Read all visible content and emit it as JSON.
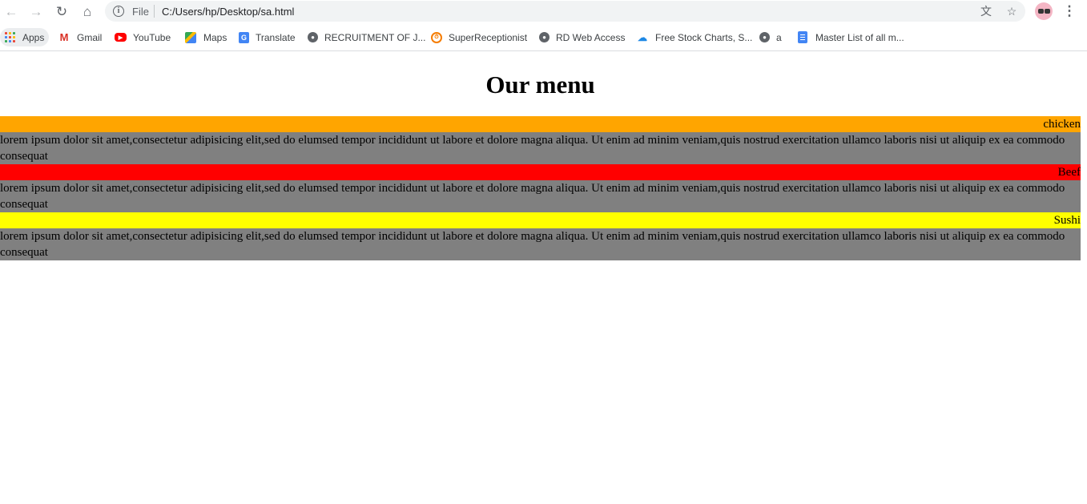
{
  "browser": {
    "scheme_label": "File",
    "url": "C:/Users/hp/Desktop/sa.html",
    "bookmarks": [
      {
        "label": "Apps",
        "icon": "apps-grid-icon"
      },
      {
        "label": "Gmail",
        "icon": "gmail-icon"
      },
      {
        "label": "YouTube",
        "icon": "youtube-icon"
      },
      {
        "label": "Maps",
        "icon": "maps-icon"
      },
      {
        "label": "Translate",
        "icon": "translate-icon"
      },
      {
        "label": "RECRUITMENT OF J...",
        "icon": "globe-icon"
      },
      {
        "label": "SuperReceptionist",
        "icon": "superreceptionist-icon"
      },
      {
        "label": "RD Web Access",
        "icon": "globe-icon"
      },
      {
        "label": "Free Stock Charts, S...",
        "icon": "cloud-icon"
      },
      {
        "label": "a",
        "icon": "globe-icon"
      },
      {
        "label": "Master List of all m...",
        "icon": "docs-icon"
      }
    ]
  },
  "page": {
    "heading": "Our menu",
    "items": [
      {
        "title": "chicken",
        "color": "#ffa500",
        "description": "lorem ipsum dolor sit amet,consectetur adipisicing elit,sed do elumsed tempor incididunt ut labore et dolore magna aliqua. Ut enim ad minim veniam,quis nostrud exercitation ullamco laboris nisi ut aliquip ex ea commodo consequat"
      },
      {
        "title": "Beef",
        "color": "#ff0000",
        "description": "lorem ipsum dolor sit amet,consectetur adipisicing elit,sed do elumsed tempor incididunt ut labore et dolore magna aliqua. Ut enim ad minim veniam,quis nostrud exercitation ullamco laboris nisi ut aliquip ex ea commodo consequat"
      },
      {
        "title": "Sushi",
        "color": "#ffff00",
        "description": "lorem ipsum dolor sit amet,consectetur adipisicing elit,sed do elumsed tempor incididunt ut labore et dolore magna aliqua. Ut enim ad minim veniam,quis nostrud exercitation ullamco laboris nisi ut aliquip ex ea commodo consequat"
      }
    ]
  }
}
